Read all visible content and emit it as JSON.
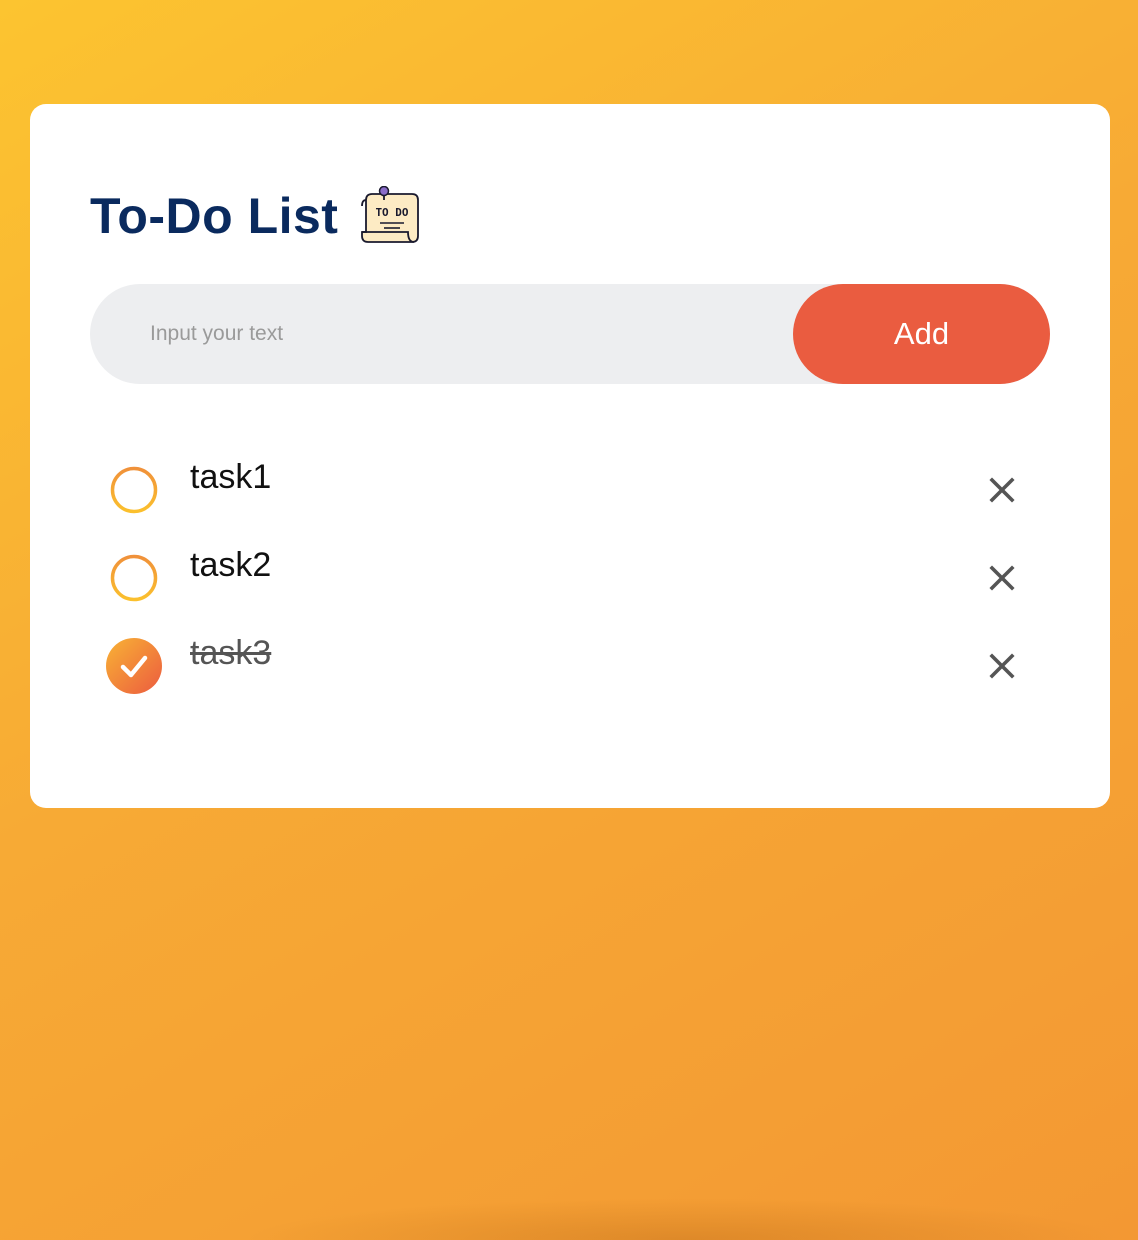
{
  "app": {
    "title": "To-Do List",
    "title_icon": "todo-note-icon",
    "title_icon_text": "TO DO"
  },
  "input": {
    "placeholder": "Input your text",
    "value": ""
  },
  "add_button": {
    "label": "Add"
  },
  "tasks": [
    {
      "text": "task1",
      "completed": false
    },
    {
      "text": "task2",
      "completed": false
    },
    {
      "text": "task3",
      "completed": true
    }
  ],
  "icons": {
    "unchecked": "circle-outline-icon",
    "checked": "check-circle-icon",
    "delete": "close-icon"
  },
  "colors": {
    "background_start": "#fcc430",
    "background_end": "#f39833",
    "card": "#ffffff",
    "title": "#0a2a5e",
    "input_bg": "#edeef0",
    "add_button": "#ea5c40",
    "check_ring_top": "#f0913a",
    "check_ring_bottom": "#fbc02d",
    "checked_fill_start": "#f8b335",
    "checked_fill_end": "#ec5b3f",
    "delete_icon": "#555555"
  }
}
